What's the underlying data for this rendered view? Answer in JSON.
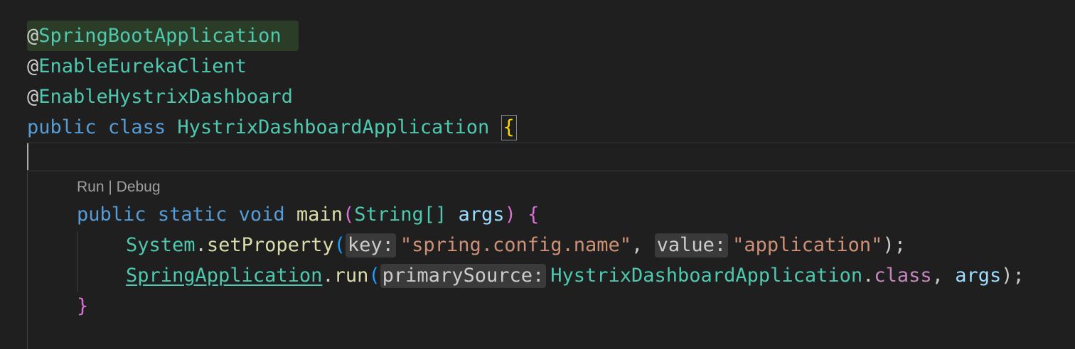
{
  "editor": {
    "annotations": [
      {
        "at": "@",
        "name": "SpringBootApplication"
      },
      {
        "at": "@",
        "name": "EnableEurekaClient"
      },
      {
        "at": "@",
        "name": "EnableHystrixDashboard"
      }
    ],
    "class_decl": {
      "kw_public": "public",
      "kw_class": "class",
      "class_name": "HystrixDashboardApplication",
      "open_brace": "{"
    },
    "codelens": {
      "run": "Run",
      "separator": " | ",
      "debug": "Debug"
    },
    "main_decl": {
      "kw_public": "public",
      "kw_static": "static",
      "kw_void": "void",
      "method": "main",
      "paren_open": "(",
      "param_type": "String[]",
      "param_name": "args",
      "paren_close": ")",
      "open_brace": "{"
    },
    "stmt1": {
      "receiver": "System",
      "dot": ".",
      "method": "setProperty",
      "paren_open": "(",
      "hint_key": "key:",
      "arg1": "\"spring.config.name\"",
      "comma": ",",
      "hint_value": "value:",
      "arg2": "\"application\"",
      "end": ");"
    },
    "stmt2": {
      "receiver": "SpringApplication",
      "dot": ".",
      "method": "run",
      "paren_open": "(",
      "hint_primary": "primarySource:",
      "arg1_type": "HystrixDashboardApplication",
      "dot2": ".",
      "arg1_class": "class",
      "comma": ",",
      "arg2": "args",
      "end": ");"
    },
    "close_brace": "}"
  },
  "colors": {
    "background": "#1f1f1f",
    "keyword": "#569cd6",
    "type": "#4ec9b0",
    "function": "#dcdcaa",
    "variable": "#9cdcfe",
    "string": "#ce9178"
  }
}
